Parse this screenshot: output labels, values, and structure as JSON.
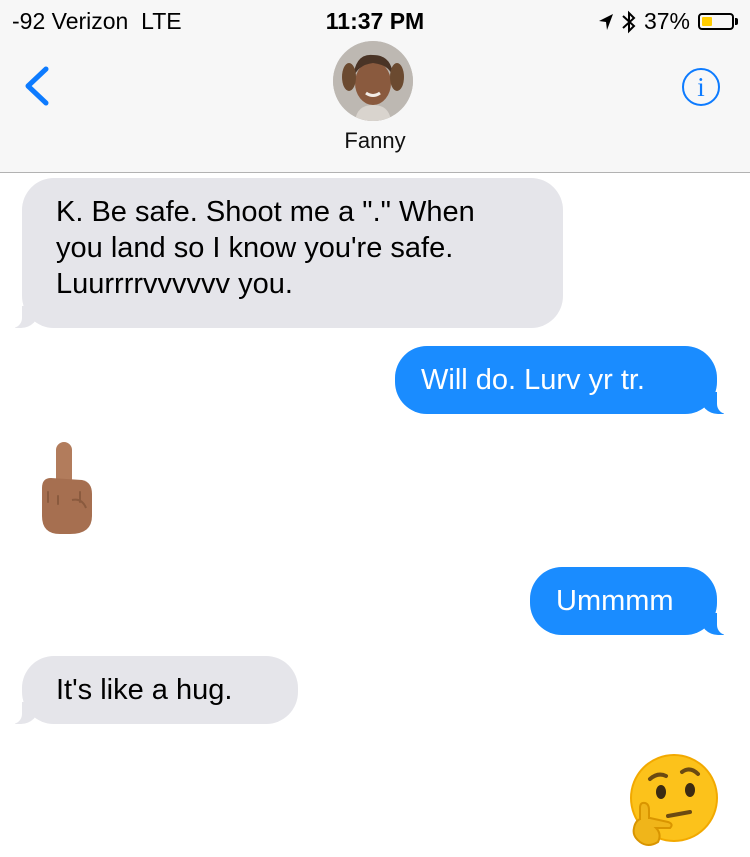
{
  "status_bar": {
    "carrier": "-92 Verizon",
    "network": "LTE",
    "time": "11:37 PM",
    "battery_percent": "37%",
    "battery_level": 0.37,
    "battery_color": "#ffcc00"
  },
  "nav": {
    "back_icon": "chevron-left-icon",
    "info_icon": "info-icon",
    "contact_name": "Fanny",
    "accent_color": "#0d7bff"
  },
  "messages": [
    {
      "direction": "incoming",
      "type": "text",
      "text": "K. Be safe. Shoot me a \".\" When you land so I know you're safe. Luurrrrvvvvvv you."
    },
    {
      "direction": "outgoing",
      "type": "text",
      "text": "Will do. Lurv yr tr."
    },
    {
      "direction": "incoming",
      "type": "emoji",
      "icon": "middle-finger-emoji"
    },
    {
      "direction": "outgoing",
      "type": "text",
      "text": "Ummmm"
    },
    {
      "direction": "incoming",
      "type": "text",
      "text": "It's like a hug."
    },
    {
      "direction": "outgoing",
      "type": "emoji",
      "icon": "thinking-face-emoji"
    }
  ],
  "colors": {
    "incoming_bubble": "#e5e5ea",
    "outgoing_bubble": "#1a8cff"
  }
}
